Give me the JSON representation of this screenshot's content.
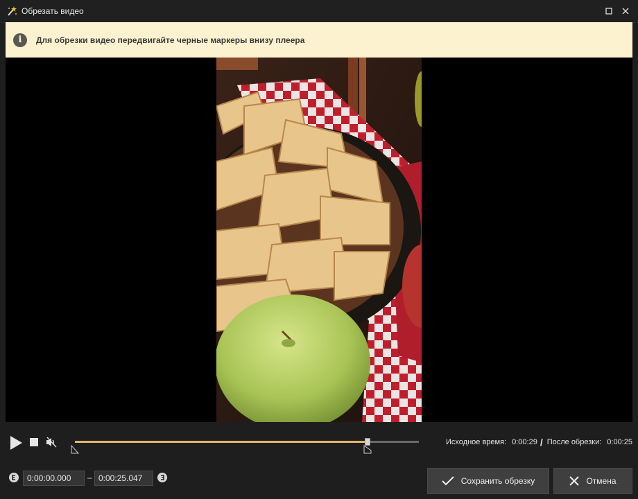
{
  "window": {
    "title": "Обрезать видео",
    "app_icon": "magic-wand-icon",
    "buttons": [
      "maximize-icon",
      "close-icon"
    ]
  },
  "info": {
    "icon": "info-icon",
    "glyph": "i",
    "text": "Для обрезки видео передвигайте черные маркеры внизу плеера"
  },
  "player": {
    "content": "video-frame-apple-pie"
  },
  "playback": {
    "position_fraction": 0.85,
    "trim_start_fraction": 0.0,
    "trim_end_fraction": 0.85,
    "source_label": "Исходное время:",
    "source_value": "0:00:29",
    "separator": "/",
    "after_label": "После обрезки:",
    "after_value": "0:00:25"
  },
  "trim": {
    "start_value": "0:00:00.000",
    "dash": "–",
    "end_value": "0:00:25.047"
  },
  "buttons": {
    "save_label": "Сохранить обрезку",
    "cancel_label": "Отмена"
  },
  "colors": {
    "accent": "#e6b66c",
    "info_bg": "#fdf2cf",
    "window_bg": "#1e1e1e",
    "button_bg": "#3f3f3f"
  }
}
